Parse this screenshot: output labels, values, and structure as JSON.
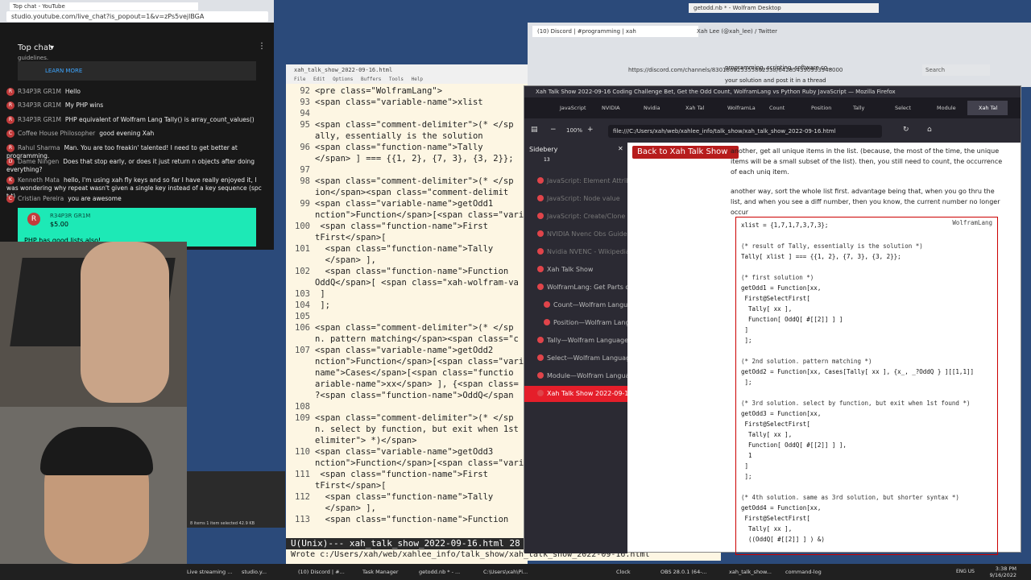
{
  "chat": {
    "tab_title": "Top chat - YouTube",
    "url": "studio.youtube.com/live_chat?is_popout=1&v=zPs5vejlBGA",
    "header": "Top chat",
    "learn_more": "LEARN MORE",
    "partial_top": "guidelines.",
    "messages": [
      {
        "author": "R34P3R GR1M",
        "text": "Hello",
        "initial": "R"
      },
      {
        "author": "R34P3R GR1M",
        "text": "My PHP wins",
        "initial": "R"
      },
      {
        "author": "R34P3R GR1M",
        "text": "PHP equivalent of Wolfram Lang Tally() is array_count_values()",
        "initial": "R"
      },
      {
        "author": "Coffee House Philosopher",
        "text": "good evening Xah",
        "initial": "C"
      },
      {
        "author": "Rahul Sharma",
        "text": "Man. You are too freakin' talented! I need to get better at programming.",
        "initial": "R"
      },
      {
        "author": "Dame Ningen",
        "text": "Does that stop early, or does it just return n objects after doing everything?",
        "initial": "D"
      },
      {
        "author": "Kenneth Mata",
        "text": "hello, I'm using xah fly keys and so far I have really enjoyed it, I was wondering why repeat wasn't given a single key instead of a key sequence (spc t t)",
        "initial": "K"
      },
      {
        "author": "Cristian Pereira",
        "text": "you are awesome",
        "initial": "C"
      }
    ],
    "superchat": {
      "author": "R34P3R GR1M",
      "amount": "$5.00",
      "text": "PHP has good lists also!"
    }
  },
  "emacs": {
    "title": "xah_talk_show_2022-09-16.html",
    "menu": "File Edit Options Buffers Tools Help",
    "lines": [
      {
        "no": "92",
        "text": "<pre class=\"WolframLang\">"
      },
      {
        "no": "93",
        "text": "<span class=\"variable-name\">xlist"
      },
      {
        "no": "94",
        "text": ""
      },
      {
        "no": "95",
        "text": "<span class=\"comment-delimiter\">(* </sp"
      },
      {
        "no": "",
        "text": "ally, essentially is the solution"
      },
      {
        "no": "96",
        "text": "<span class=\"function-name\">Tally"
      },
      {
        "no": "",
        "text": "</span> ] === {{1, 2}, {7, 3}, {3, 2}};"
      },
      {
        "no": "97",
        "text": ""
      },
      {
        "no": "98",
        "text": "<span class=\"comment-delimiter\">(* </sp"
      },
      {
        "no": "",
        "text": "ion</span><span class=\"comment-delimit"
      },
      {
        "no": "99",
        "text": "<span class=\"variable-name\">getOdd1"
      },
      {
        "no": "",
        "text": "nction\">Function</span>[<span class=\"variable-name"
      },
      {
        "no": "100",
        "text": " <span class=\"function-name\">First"
      },
      {
        "no": "",
        "text": "tFirst</span>["
      },
      {
        "no": "101",
        "text": "  <span class=\"function-name\">Tally"
      },
      {
        "no": "",
        "text": "  </span> ],"
      },
      {
        "no": "102",
        "text": "  <span class=\"function-name\">Function"
      },
      {
        "no": "",
        "text": "OddQ</span>[ <span class=\"xah-wolfram-va"
      },
      {
        "no": "103",
        "text": " ]"
      },
      {
        "no": "104",
        "text": " ];"
      },
      {
        "no": "105",
        "text": ""
      },
      {
        "no": "106",
        "text": "<span class=\"comment-delimiter\">(* </sp"
      },
      {
        "no": "",
        "text": "n. pattern matching</span><span class=\"c"
      },
      {
        "no": "107",
        "text": "<span class=\"variable-name\">getOdd2"
      },
      {
        "no": "",
        "text": "nction\">Function</span>[<span class=\"variable-name"
      },
      {
        "no": "",
        "text": "name\">Cases</span>[<span class=\"functio"
      },
      {
        "no": "",
        "text": "ariable-name\">xx</span> ], {<span class="
      },
      {
        "no": "",
        "text": "?<span class=\"function-name\">OddQ</span"
      },
      {
        "no": "108",
        "text": ""
      },
      {
        "no": "109",
        "text": "<span class=\"comment-delimiter\">(* </sp"
      },
      {
        "no": "",
        "text": "n. select by function, but exit when 1st"
      },
      {
        "no": "",
        "text": "elimiter\"> *)</span>"
      },
      {
        "no": "110",
        "text": "<span class=\"variable-name\">getOdd3"
      },
      {
        "no": "",
        "text": "nction\">Function</span>[<span class=\"variable-name"
      },
      {
        "no": "111",
        "text": " <span class=\"function-name\">First"
      },
      {
        "no": "",
        "text": "tFirst</span>["
      },
      {
        "no": "112",
        "text": "  <span class=\"function-name\">Tally"
      },
      {
        "no": "",
        "text": "  </span> ],"
      },
      {
        "no": "113",
        "text": "  <span class=\"function-name\">Function"
      }
    ],
    "modeline": "U(Unix)---  xah_talk_show_2022-09-16.html  28",
    "echo": "Wrote c:/Users/xah/web/xahlee_info/talk_show/xah_talk_show_2022-09-16.html"
  },
  "discord": {
    "tab1": "(10) Discord | #programming | xah",
    "tab2": "Xah Lee (@xah_lee) / Twitter",
    "url": "https://discord.com/channels/830186625355862538/642854390993948000",
    "banner": "programming, scripting, software co...",
    "search": "Search",
    "side_note": "your solution and post it in a thread",
    "wolfram_tab": "getodd.nb * - Wolfram Desktop"
  },
  "firefox": {
    "title": "Xah Talk Show 2022-09-16 Coding Challenge Bet, Get the Odd Count, WolframLang vs Python Ruby JavaScript — Mozilla Firefox",
    "tabs": [
      "JavaScript",
      "NVIDIA",
      "Nvidia",
      "Xah Tal",
      "WolframLa",
      "Count",
      "Position",
      "Tally",
      "Select",
      "Module",
      "Xah Tal"
    ],
    "zoom": "100%",
    "url": "file:///C:/Users/xah/web/xahlee_info/talk_show/xah_talk_show_2022-09-16.html",
    "sidebery": {
      "title": "Sidebery",
      "badge": "13",
      "items": [
        {
          "label": "JavaScript: Element Attribute",
          "state": "dim"
        },
        {
          "label": "JavaScript: Node value",
          "state": "dim"
        },
        {
          "label": "JavaScript: Create/Clone Ele",
          "state": "dim"
        },
        {
          "label": "NVIDIA Nvenc Obs Guide | G",
          "state": "dim"
        },
        {
          "label": "Nvidia NVENC - Wikipedia",
          "state": "dim"
        },
        {
          "label": "Xah Talk Show",
          "state": "normal"
        },
        {
          "label": "WolframLang: Get Parts of L",
          "state": "normal"
        },
        {
          "label": "Count—Wolfram Language",
          "state": "child"
        },
        {
          "label": "Position—Wolfram Langua",
          "state": "child"
        },
        {
          "label": "Tally—Wolfram Language D",
          "state": "normal"
        },
        {
          "label": "Select—Wolfram Language",
          "state": "normal"
        },
        {
          "label": "Module—Wolfram Language",
          "state": "normal"
        },
        {
          "label": "Xah Talk Show 2022-09-16",
          "state": "active"
        }
      ]
    },
    "back_button": "Back to Xah Talk Show",
    "para1": "another, get all unique items in the list. (because, the most of the time, the unique items will be a small subset of the list). then, you still need to count, the occurrence of each uniq item.",
    "para2": "another way, sort the whole list first. advantage being that, when you go thru the list, and when you see a diff number, then you know, the current number no longer occur",
    "code_tag": "WolframLang",
    "code": [
      "xlist = {1,7,1,7,3,7,3};",
      "",
      "(* result of Tally, essentially is the solution *)",
      "Tally[ xlist ] === {{1, 2}, {7, 3}, {3, 2}};",
      "",
      "(* first solution *)",
      "getOdd1 = Function[xx,",
      " First@SelectFirst[",
      "  Tally[ xx ],",
      "  Function[ OddQ[ #[[2]] ] ]",
      " ]",
      " ];",
      "",
      "(* 2nd solution. pattern matching *)",
      "getOdd2 = Function[xx, Cases[Tally[ xx ], {x_, _?OddQ } ][[1,1]]",
      " ];",
      "",
      "(* 3rd solution. select by function, but exit when 1st found *)",
      "getOdd3 = Function[xx,",
      " First@SelectFirst[",
      "  Tally[ xx ],",
      "  Function[ OddQ[ #[[2]] ] ],",
      "  1",
      " ]",
      " ];",
      "",
      "(* 4th solution. same as 3rd solution, but shorter syntax *)",
      "getOdd4 = Function[xx,",
      " First@SelectFirst[",
      "  Tally[ xx ],",
      "  ((OddQ[ #[[2]] ] ) &)"
    ]
  },
  "taskbar": {
    "items": [
      "Live streaming ...",
      "studio.y...",
      "(10) Discord | #...",
      "Task Manager",
      "getodd.nb * - ...",
      "C:\\Users\\xah\\Pi...",
      "Clock",
      "OBS 28.0.1 (64-...",
      "xah_talk_show...",
      "command-log"
    ],
    "time": "3:38 PM",
    "date": "9/16/2022",
    "lang": "ENG US"
  },
  "explorer": {
    "status": "8 items   1 item selected  42.9 KB"
  }
}
